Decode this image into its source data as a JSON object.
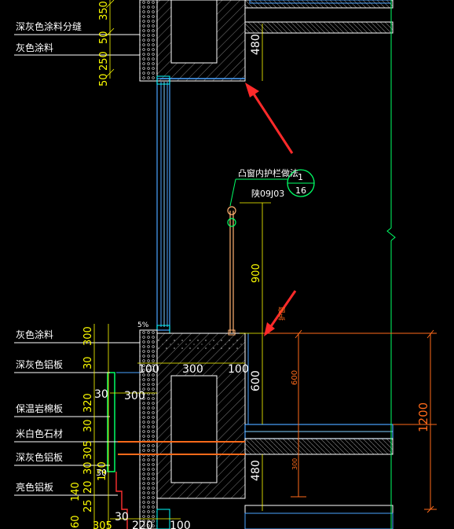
{
  "labels": {
    "dark_gray_paint_joint": "深灰色涂料分缝",
    "gray_paint_top": "灰色涂料",
    "gray_paint": "灰色涂料",
    "dark_gray_aluminum_1": "深灰色铝板",
    "rock_wool_board": "保温岩棉板",
    "off_white_stone": "米白色石材",
    "dark_gray_aluminum_2": "深灰色铝板",
    "bright_aluminum": "亮色铝板"
  },
  "callout": {
    "title": "凸窗内护栏做法",
    "ref_top": "1",
    "ref_bottom": "16",
    "atlas": "陕09J03",
    "note": "护窗",
    "slope": "5%"
  },
  "dims_left": [
    "350",
    "50",
    "250",
    "50",
    "300",
    "30",
    "320",
    "30",
    "305",
    "30",
    "120",
    "140",
    "20",
    "25",
    "60",
    "305",
    "30"
  ],
  "dims_vertical": [
    "480",
    "900",
    "600",
    "480"
  ],
  "dims_horizontal": [
    "100",
    "300",
    "100",
    "30",
    "300",
    "30",
    "100",
    "220"
  ],
  "dims_orange": [
    "600",
    "1200",
    "300"
  ],
  "colors": {
    "background": "#000000",
    "concrete": "#ffffff",
    "glass": "#4aa3ff",
    "green": "#00ff66",
    "yellow": "#ffff00",
    "orange": "#ff6a1a",
    "red_arrow": "#ff2a2a",
    "hatch": "#888888"
  }
}
